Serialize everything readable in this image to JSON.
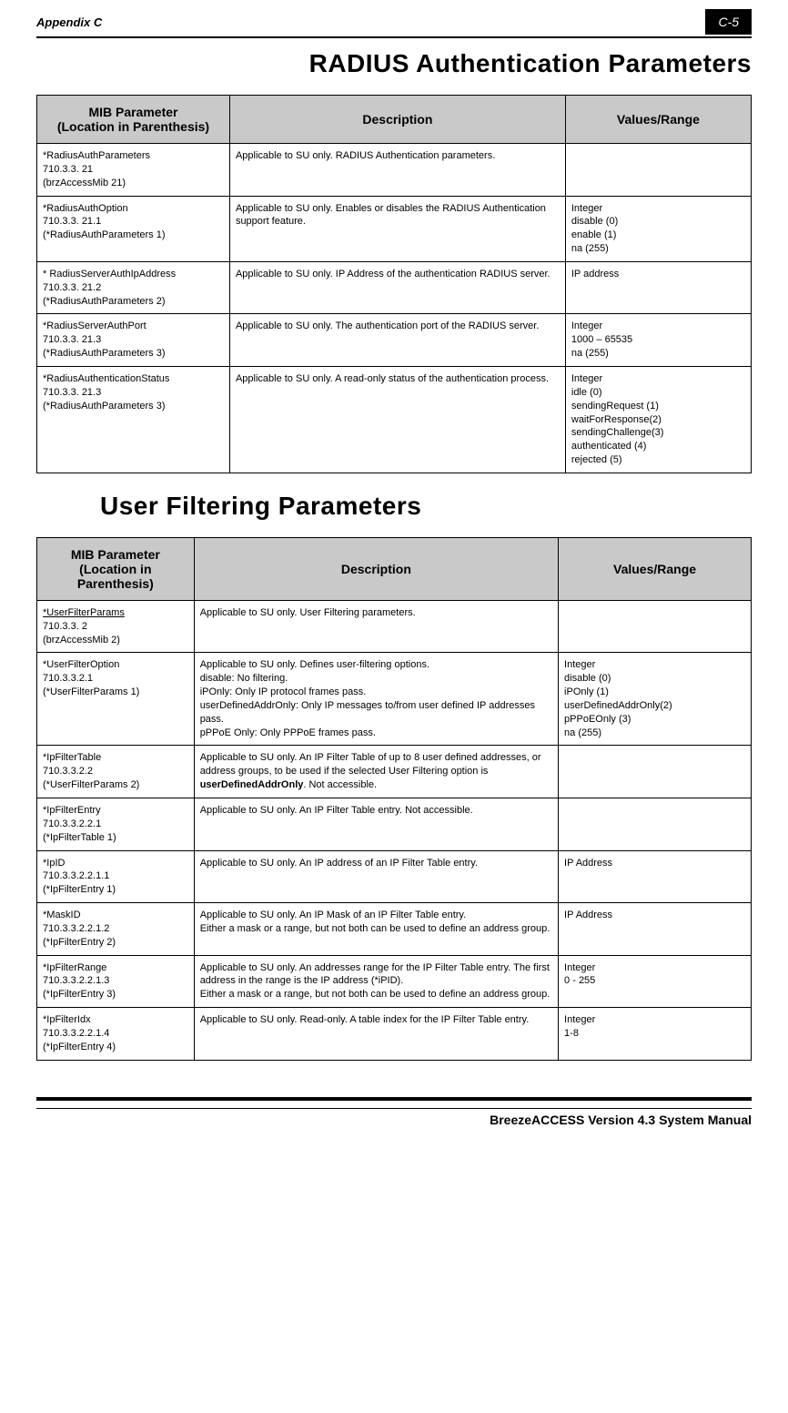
{
  "header": {
    "appendix": "Appendix C",
    "page_num": "C-5"
  },
  "section1": {
    "title": "RADIUS Authentication Parameters",
    "headers": {
      "param": "MIB Parameter\n(Location in Parenthesis)",
      "desc": "Description",
      "val": "Values/Range"
    },
    "rows": [
      {
        "param": "*RadiusAuthParameters\n710.3.3. 21\n(brzAccessMib 21)",
        "desc": "Applicable to SU only. RADIUS Authentication parameters.",
        "val": ""
      },
      {
        "param": "*RadiusAuthOption\n710.3.3. 21.1\n(*RadiusAuthParameters 1)",
        "desc": "Applicable to SU only. Enables or disables the RADIUS Authentication support feature.",
        "val": "Integer\ndisable (0)\nenable (1)\nna (255)"
      },
      {
        "param": "* RadiusServerAuthIpAddress\n710.3.3. 21.2\n(*RadiusAuthParameters 2)",
        "desc": "Applicable to SU only. IP Address of the authentication RADIUS server.",
        "val": "IP address"
      },
      {
        "param": "*RadiusServerAuthPort\n710.3.3. 21.3\n(*RadiusAuthParameters 3)",
        "desc": "Applicable to SU only. The authentication port of the RADIUS server.",
        "val": "Integer\n1000 – 65535\nna (255)"
      },
      {
        "param": "*RadiusAuthenticationStatus\n710.3.3. 21.3\n(*RadiusAuthParameters 3)",
        "desc": "Applicable to SU only. A read-only status of the authentication process.",
        "val": "Integer\nidle (0)\nsendingRequest (1)\nwaitForResponse(2)\nsendingChallenge(3)\nauthenticated (4)\nrejected (5)"
      }
    ]
  },
  "section2": {
    "title": "User Filtering Parameters",
    "headers": {
      "param": "MIB Parameter\n(Location in Parenthesis)",
      "desc": "Description",
      "val": "Values/Range"
    },
    "rows": [
      {
        "param_underline": "*UserFilterParams",
        "param_rest": "710.3.3. 2\n(brzAccessMib 2)",
        "desc": "Applicable to SU only. User Filtering parameters.",
        "val": ""
      },
      {
        "param": "*UserFilterOption\n710.3.3.2.1\n(*UserFilterParams 1)",
        "desc": "Applicable to SU only. Defines user-filtering options.\ndisable: No filtering.\niPOnly: Only IP protocol frames pass.\nuserDefinedAddrOnly: Only IP messages to/from user defined IP addresses pass.\npPPoE Only: Only PPPoE frames pass.",
        "val": "Integer\ndisable (0)\niPOnly (1)\nuserDefinedAddrOnly(2)\npPPoEOnly (3)\nna (255)"
      },
      {
        "param": "*IpFilterTable\n710.3.3.2.2\n(*UserFilterParams 2)",
        "desc_pre": "Applicable to SU only. An IP Filter Table of up to 8 user defined addresses, or address groups, to be used if the selected User Filtering option is ",
        "desc_bold": "userDefinedAddrOnly",
        "desc_post": ". Not accessible.",
        "val": ""
      },
      {
        "param": "*IpFilterEntry\n710.3.3.2.2.1\n(*IpFilterTable 1)",
        "desc": "Applicable to SU only. An IP Filter Table entry. Not accessible.",
        "val": ""
      },
      {
        "param": "*IpID\n710.3.3.2.2.1.1\n(*IpFilterEntry 1)",
        "desc": "Applicable to SU only. An IP address of an IP Filter Table entry.",
        "val": "IP Address"
      },
      {
        "param": "*MaskID\n710.3.3.2.2.1.2\n(*IpFilterEntry 2)",
        "desc": "Applicable to SU only. An IP Mask of an IP Filter Table entry.\nEither a mask or a range, but not both can be used to define an address group.",
        "val": "IP Address"
      },
      {
        "param": "*IpFilterRange\n710.3.3.2.2.1.3\n(*IpFilterEntry 3)",
        "desc": "Applicable to SU only. An addresses range for the IP Filter Table entry. The first address in the range is the IP address (*iPID).\nEither a mask or a range, but not both can be used to define an address group.",
        "val": "Integer\n0 - 255"
      },
      {
        "param": "*IpFilterIdx\n710.3.3.2.2.1.4\n(*IpFilterEntry 4)",
        "desc": "Applicable to SU only. Read-only. A table index for the IP Filter Table entry.",
        "val": "Integer\n1-8"
      }
    ]
  },
  "footer": {
    "text": "BreezeACCESS Version 4.3 System Manual"
  }
}
